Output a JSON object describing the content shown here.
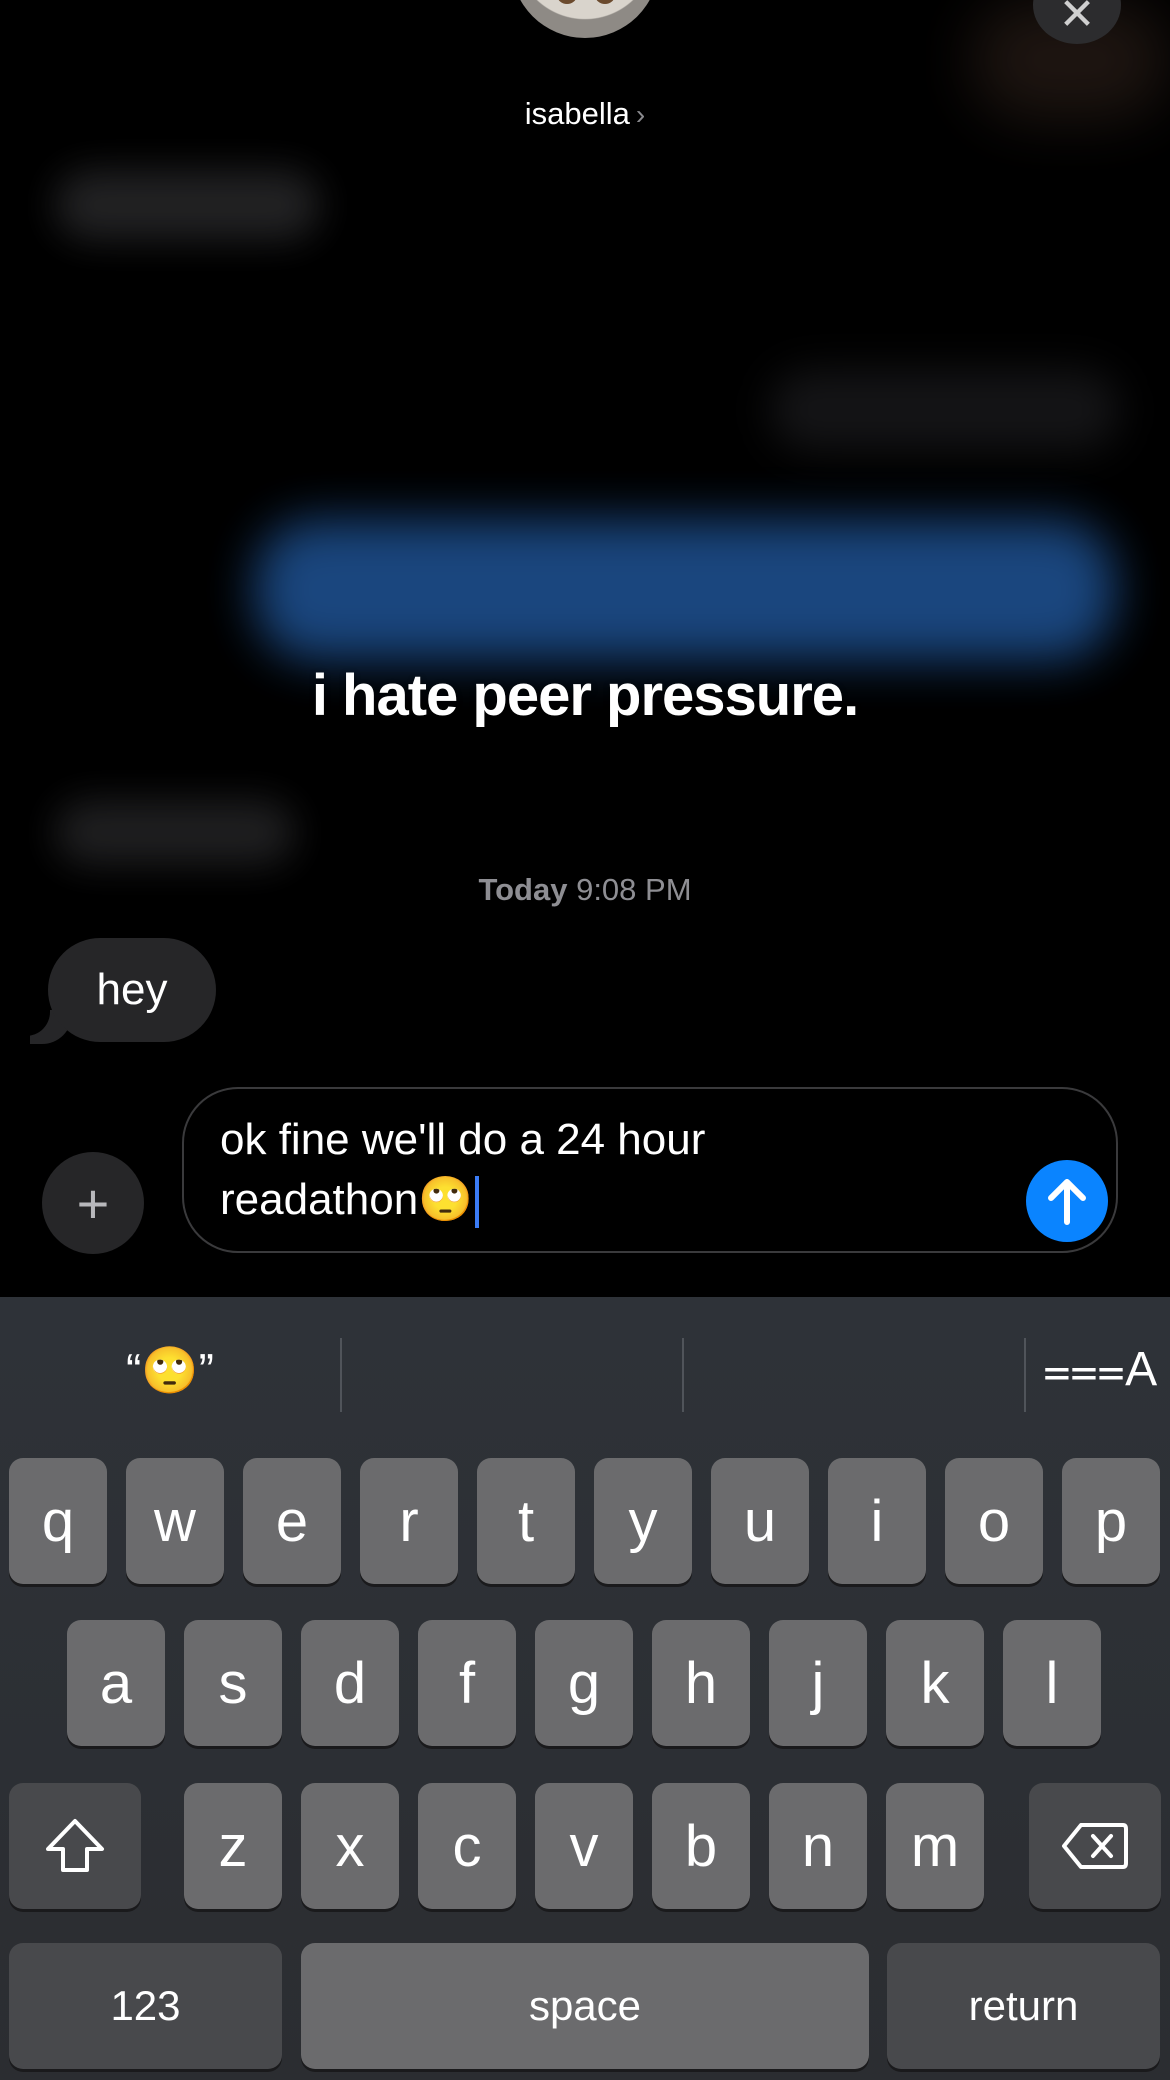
{
  "header": {
    "contact_name": "isabella",
    "chevron": "›",
    "close_glyph": "✕"
  },
  "overlay": {
    "caption": "i hate peer pressure."
  },
  "thread": {
    "timestamp_day": "Today",
    "timestamp_time": "9:08 PM",
    "incoming_message": "hey"
  },
  "composer": {
    "plus_glyph": "+",
    "text_line1": "ok fine we'll do a 24 hour",
    "text_line2": "readathon🙄"
  },
  "keyboard": {
    "suggestion": "“🙄”",
    "format_glyph": "⩶A",
    "row1": [
      "q",
      "w",
      "e",
      "r",
      "t",
      "y",
      "u",
      "i",
      "o",
      "p"
    ],
    "row2": [
      "a",
      "s",
      "d",
      "f",
      "g",
      "h",
      "j",
      "k",
      "l"
    ],
    "row3": [
      "z",
      "x",
      "c",
      "v",
      "b",
      "n",
      "m"
    ],
    "shift_glyph": "⇧",
    "delete_glyph": "⌫",
    "numbers_label": "123",
    "space_label": "space",
    "return_label": "return"
  },
  "colors": {
    "accent": "#0a84ff",
    "bubble": "#262628",
    "key": "#6b6b6d"
  }
}
